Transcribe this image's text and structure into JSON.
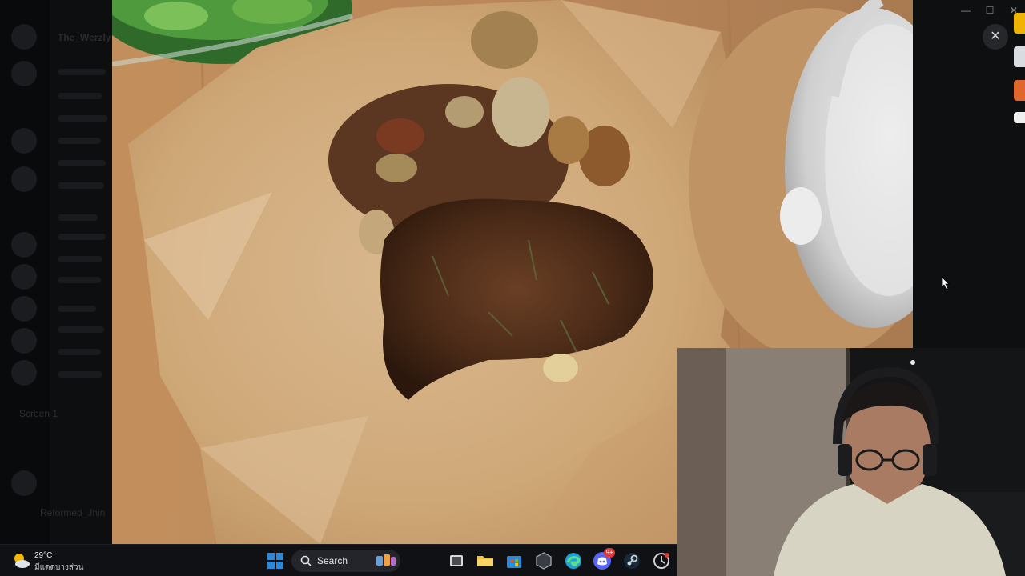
{
  "discord": {
    "server_title": "The_Werzly",
    "screen_label": "Screen 1",
    "user_name": "Reformed_Jhin"
  },
  "viewer": {
    "close_glyph": "✕",
    "minimize_glyph": "—",
    "maximize_glyph": "☐",
    "close_window_glyph": "✕"
  },
  "taskbar": {
    "weather": {
      "temperature": "29°C",
      "description": "มีแดดบางส่วน",
      "icon": "partly-sunny-icon"
    },
    "search_label": "Search",
    "icons": [
      "windows-start-icon",
      "search-icon",
      "widget-icon",
      "task-view-icon",
      "file-explorer-icon",
      "microsoft-store-icon",
      "app-icon",
      "edge-icon",
      "discord-icon",
      "steam-icon",
      "app-icon"
    ],
    "discord_badge": "9+"
  },
  "colors": {
    "taskbar_bg": "#101114",
    "accent_blue": "#2b88d8",
    "discord_blurple": "#5865f2"
  }
}
